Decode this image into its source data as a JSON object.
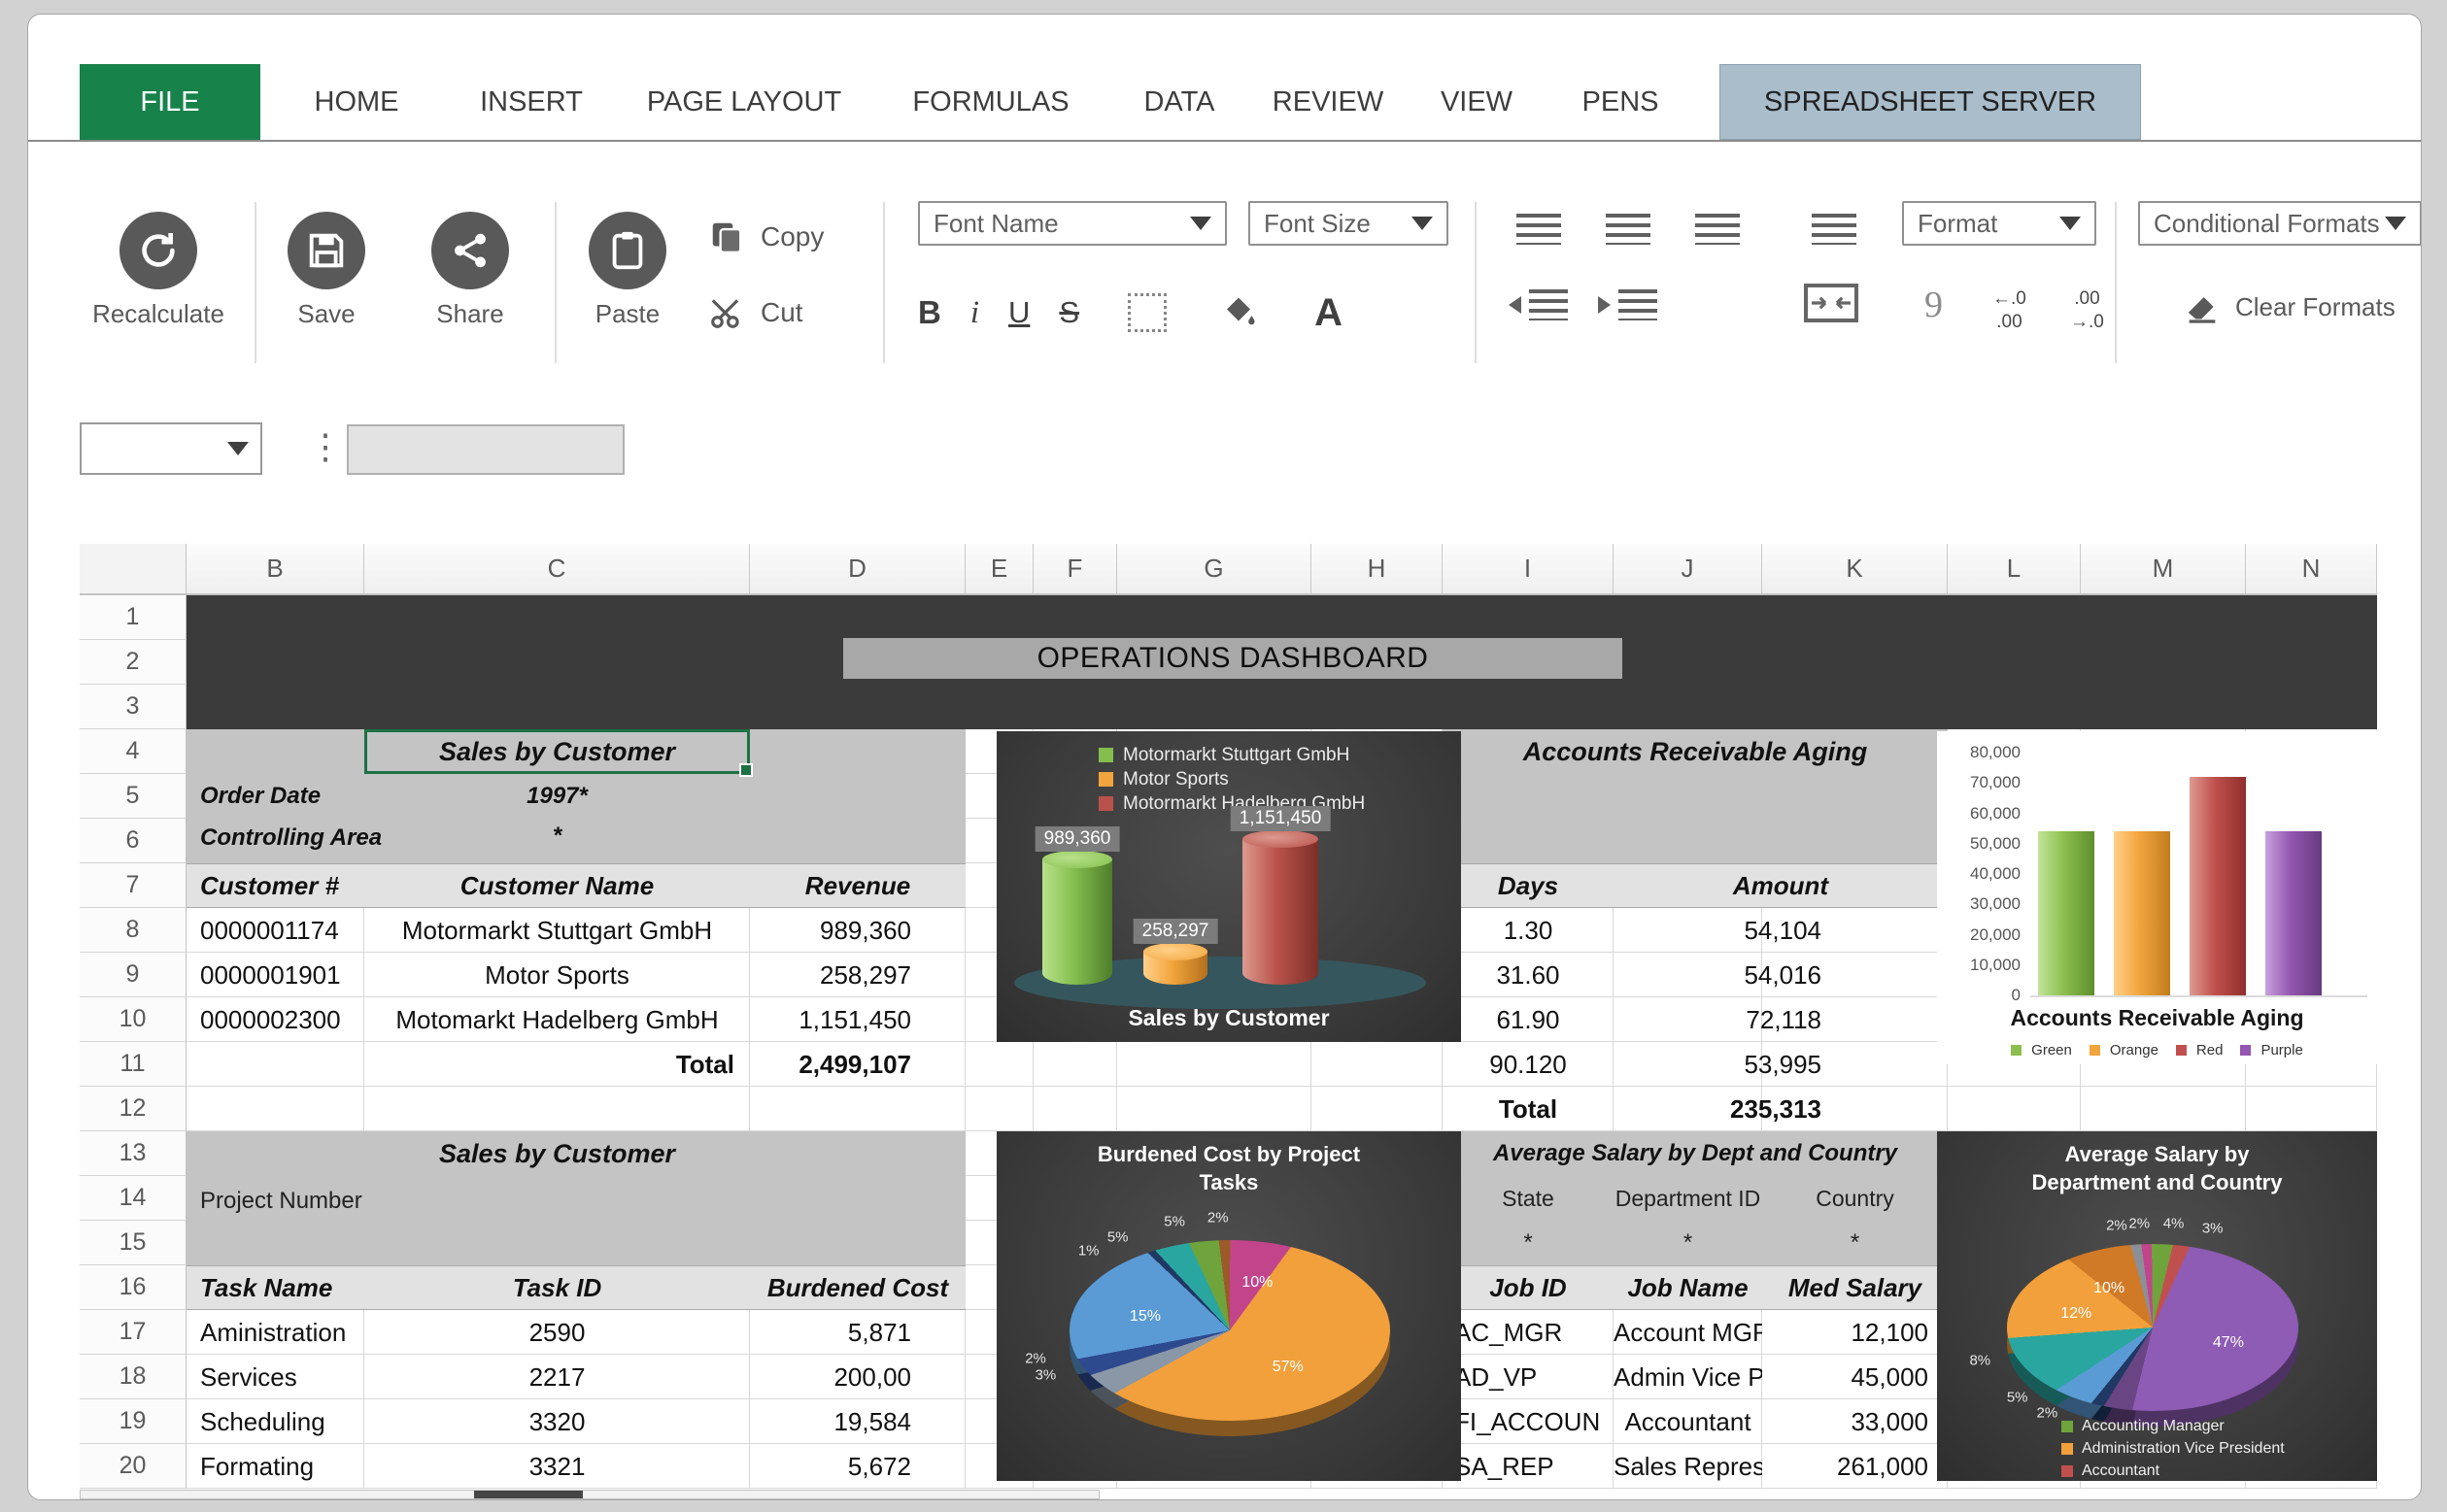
{
  "ribbon_tabs": [
    "FILE",
    "HOME",
    "INSERT",
    "PAGE LAYOUT",
    "FORMULAS",
    "DATA",
    "REVIEW",
    "VIEW",
    "PENS",
    "SPREADSHEET SERVER"
  ],
  "ribbon": {
    "recalculate": "Recalculate",
    "save": "Save",
    "share": "Share",
    "paste": "Paste",
    "copy": "Copy",
    "cut": "Cut",
    "font_name": "Font Name",
    "font_size": "Font Size",
    "bold": "B",
    "italic": "i",
    "underline": "U",
    "strikethrough": "S",
    "font_color": "A",
    "format": "Format",
    "conditional_formats": "Conditional Formats",
    "clear_formats": "Clear Formats",
    "superscript": "9",
    "decimal_left_top": "←.0",
    "decimal_left_bottom": ".00",
    "decimal_right_top": ".00",
    "decimal_right_bottom": "→.0"
  },
  "formula_bar": {
    "name_box": "",
    "range_box": "",
    "formula_input": ""
  },
  "grid": {
    "columns": [
      "B",
      "C",
      "D",
      "E",
      "F",
      "G",
      "H",
      "I",
      "J",
      "K",
      "L",
      "M",
      "N"
    ],
    "rows": [
      "1",
      "2",
      "3",
      "4",
      "5",
      "6",
      "7",
      "8",
      "9",
      "10",
      "11",
      "12",
      "13",
      "14",
      "15",
      "16",
      "17",
      "18",
      "19",
      "20"
    ]
  },
  "dashboard_title": "OPERATIONS DASHBOARD",
  "sales": {
    "title": "Sales by Customer",
    "order_date_label": "Order Date",
    "order_date_value": "1997*",
    "controlling_area_label": "Controlling Area",
    "controlling_area_value": "*",
    "headers": [
      "Customer  #",
      "Customer Name",
      "Revenue"
    ],
    "rows": [
      [
        "0000001174",
        "Motormarkt Stuttgart GmbH",
        "989,360"
      ],
      [
        "0000001901",
        "Motor Sports",
        "258,297"
      ],
      [
        "0000002300",
        "Motomarkt Hadelberg GmbH",
        "1,151,450"
      ]
    ],
    "total_label": "Total",
    "total_value": "2,499,107"
  },
  "aging": {
    "title": "Accounts Receivable Aging",
    "headers": [
      "Days",
      "Amount"
    ],
    "rows": [
      [
        "1.30",
        "54,104"
      ],
      [
        "31.60",
        "54,016"
      ],
      [
        "61.90",
        "72,118"
      ],
      [
        "90.120",
        "53,995"
      ]
    ],
    "total_label": "Total",
    "total_value": "235,313"
  },
  "tasks": {
    "title": "Sales by Customer",
    "project_number_label": "Project Number",
    "headers": [
      "Task Name",
      "Task ID",
      "Burdened Cost"
    ],
    "rows": [
      [
        "Aministration",
        "2590",
        "5,871"
      ],
      [
        "Services",
        "2217",
        "200,00"
      ],
      [
        "Scheduling",
        "3320",
        "19,584"
      ],
      [
        "Formating",
        "3321",
        "5,672"
      ]
    ]
  },
  "salary": {
    "title": "Average Salary by Dept and Country",
    "filter_headers": [
      "State",
      "Department ID",
      "Country"
    ],
    "filter_values": [
      "*",
      "*",
      "*"
    ],
    "headers": [
      "Job ID",
      "Job Name",
      "Med Salary"
    ],
    "rows": [
      [
        "AC_MGR",
        "Account MGR",
        "12,100"
      ],
      [
        "AD_VP",
        "Admin Vice Pre",
        "45,000"
      ],
      [
        "FI_ACCOUN",
        "Accountant",
        "33,000"
      ],
      [
        "SA_REP",
        "Sales Represen",
        "261,000"
      ]
    ]
  },
  "chart_data": [
    {
      "type": "bar",
      "variant": "3d-cylinder",
      "title": "Sales by Customer",
      "background": "#3E3E3E",
      "categories": [
        "Motormarkt Stuttgart GmbH",
        "Motor Sports",
        "Motormarkt Hadelberg GmbH"
      ],
      "values": [
        989360,
        258297,
        1151450
      ],
      "data_labels": [
        "989,360",
        "258,297",
        "1,151,450"
      ],
      "ymax": 1151450,
      "legend_position": "top-left",
      "colors": [
        {
          "light": "#b9e18b",
          "base": "#84bf4e",
          "dark": "#4e7d2a"
        },
        {
          "light": "#ffd08a",
          "base": "#f2a53c",
          "dark": "#b36f1d"
        },
        {
          "light": "#dd9a90",
          "base": "#b9524a",
          "dark": "#7d2f2a"
        }
      ]
    },
    {
      "type": "bar",
      "title": "Accounts Receivable Aging",
      "background": "#FFFFFF",
      "categories": [
        "Green",
        "Orange",
        "Red",
        "Purple"
      ],
      "values": [
        54104,
        54016,
        72118,
        53995
      ],
      "ylim": [
        0,
        80000
      ],
      "ytick_labels": [
        "80,000",
        "70,000",
        "60,000",
        "50,000",
        "40,000",
        "30,000",
        "20,000",
        "10,000",
        "0"
      ],
      "legend_position": "bottom",
      "grid": false,
      "colors": [
        {
          "light": "#c2e59a",
          "base": "#8cbf4e",
          "dark": "#5d8f2e"
        },
        {
          "light": "#ffd08a",
          "base": "#f2a53c",
          "dark": "#c27c1f"
        },
        {
          "light": "#dd9a90",
          "base": "#c0504d",
          "dark": "#8f2f2c"
        },
        {
          "light": "#c9a0dd",
          "base": "#9456b0",
          "dark": "#663a80"
        }
      ]
    },
    {
      "type": "pie",
      "title": "Burdened Cost by Project Tasks",
      "title_lines": [
        "Burdened Cost by Project",
        "Tasks"
      ],
      "background": "#3E3E3E",
      "start_angle": -25,
      "slices": [
        {
          "label": "5%",
          "value": 5,
          "color": "#6fa33c"
        },
        {
          "label": "2%",
          "value": 2,
          "color": "#9c5a2a"
        },
        {
          "label": "10%",
          "value": 10,
          "color": "#c2458c"
        },
        {
          "label": "57%",
          "value": 57,
          "color": "#f2a03c"
        },
        {
          "label": "3%",
          "value": 3,
          "color": "#8a97a6"
        },
        {
          "label": "2%",
          "value": 2,
          "color": "#2e4a8f"
        },
        {
          "label": "15%",
          "value": 15,
          "color": "#5b9bd5"
        },
        {
          "label": "1%",
          "value": 1,
          "color": "#1f3864"
        },
        {
          "label": "5%",
          "value": 5,
          "color": "#2aa6a0"
        }
      ]
    },
    {
      "type": "pie",
      "title": "Average Salary by Department and Country",
      "title_lines": [
        "Average Salary by",
        "Department and Country"
      ],
      "background": "#3E3E3E",
      "start_angle": -15,
      "slices": [
        {
          "label": "2%",
          "value": 2,
          "color": "#8a8f98"
        },
        {
          "label": "2%",
          "value": 2,
          "color": "#c2458c"
        },
        {
          "label": "4%",
          "value": 4,
          "color": "#6fa33c"
        },
        {
          "label": "3%",
          "value": 3,
          "color": "#c0504d"
        },
        {
          "label": "47%",
          "value": 47,
          "color": "#8e5bb5"
        },
        {
          "label": "",
          "value": 5,
          "color": "#6a4584"
        },
        {
          "label": "2%",
          "value": 2,
          "color": "#1f3864"
        },
        {
          "label": "5%",
          "value": 5,
          "color": "#5b9bd5"
        },
        {
          "label": "8%",
          "value": 8,
          "color": "#2aa6a0"
        },
        {
          "label": "12%",
          "value": 12,
          "color": "#f2a03c"
        },
        {
          "label": "10%",
          "value": 10,
          "color": "#d07a28"
        }
      ],
      "legend": [
        {
          "label": "Accounting Manager",
          "color": "#6fa33c"
        },
        {
          "label": "Administration Vice President",
          "color": "#f2a03c"
        },
        {
          "label": "Accountant",
          "color": "#c0504d"
        }
      ]
    }
  ]
}
